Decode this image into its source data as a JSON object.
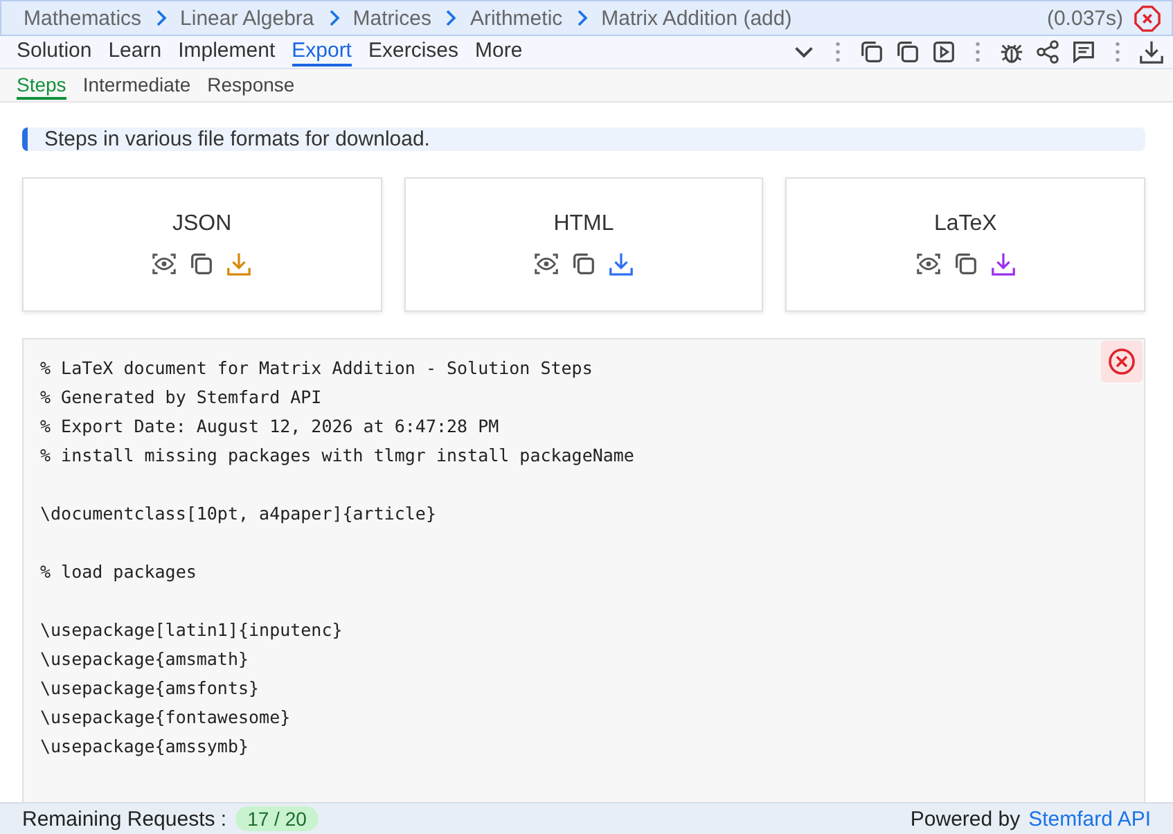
{
  "breadcrumb": [
    "Mathematics",
    "Linear Algebra",
    "Matrices",
    "Arithmetic",
    "Matrix Addition (add)"
  ],
  "timing": "(0.037s)",
  "tabs": [
    {
      "label": "Solution",
      "selected": false
    },
    {
      "label": "Learn",
      "selected": false
    },
    {
      "label": "Implement",
      "selected": false
    },
    {
      "label": "Export",
      "selected": true
    },
    {
      "label": "Exercises",
      "selected": false
    },
    {
      "label": "More",
      "selected": false
    }
  ],
  "subtabs": [
    {
      "label": "Steps",
      "selected": true
    },
    {
      "label": "Intermediate",
      "selected": false
    },
    {
      "label": "Response",
      "selected": false
    }
  ],
  "info": "Steps in various file formats for download.",
  "formats": [
    {
      "label": "JSON",
      "color": "#d98a0b"
    },
    {
      "label": "HTML",
      "color": "#2f6ff5"
    },
    {
      "label": "LaTeX",
      "color": "#9b30f0"
    }
  ],
  "code": {
    "blocks": [
      [
        "% LaTeX document for Matrix Addition - Solution Steps",
        "% Generated by Stemfard API",
        "% Export Date: August 12, 2026 at 6:47:28 PM",
        "% install missing packages with tlmgr install packageName"
      ],
      [
        "\\documentclass[10pt, a4paper]{article}"
      ],
      [
        "% load packages"
      ],
      [
        "\\usepackage[latin1]{inputenc}",
        "\\usepackage{amsmath}",
        "\\usepackage{amsfonts}",
        "\\usepackage{fontawesome}",
        "\\usepackage{amssymb}"
      ]
    ]
  },
  "footer": {
    "label": "Remaining Requests :",
    "count": "17 / 20",
    "powered": "Powered by",
    "link": "Stemfard API"
  }
}
